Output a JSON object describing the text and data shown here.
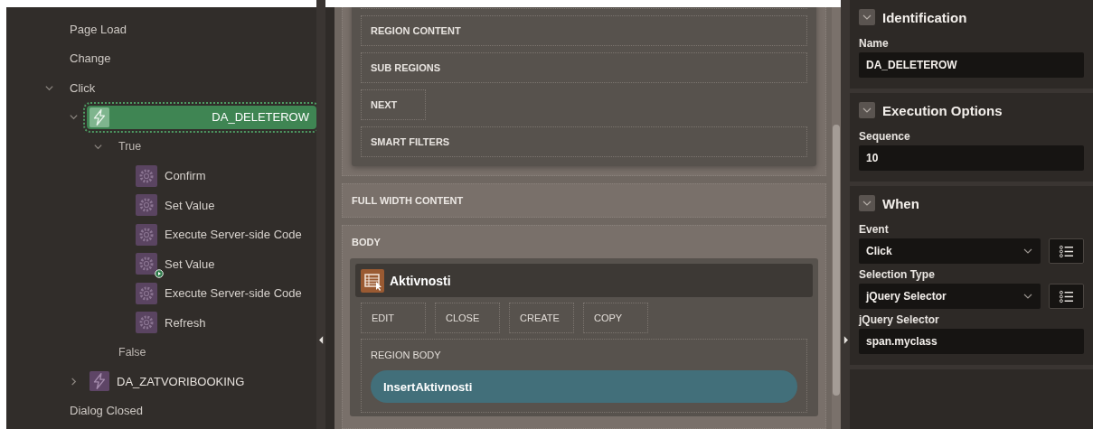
{
  "tree": [
    {
      "label": "Page Load",
      "kind": "event"
    },
    {
      "label": "Change",
      "kind": "event"
    },
    {
      "label": "Click",
      "kind": "event",
      "expanded": true,
      "children": [
        {
          "label": "DA_DELETEROW",
          "kind": "dynamic-action",
          "expanded": true,
          "selected": true,
          "children": [
            {
              "label": "True",
              "kind": "branch",
              "expanded": true,
              "children": [
                {
                  "label": "Confirm",
                  "kind": "action",
                  "marker": false
                },
                {
                  "label": "Set Value",
                  "kind": "action",
                  "marker": false
                },
                {
                  "label": "Execute Server-side Code",
                  "kind": "action",
                  "marker": false
                },
                {
                  "label": "Set Value",
                  "kind": "action",
                  "marker": true
                },
                {
                  "label": "Execute Server-side Code",
                  "kind": "action",
                  "marker": false
                },
                {
                  "label": "Refresh",
                  "kind": "action",
                  "marker": false
                }
              ]
            },
            {
              "label": "False",
              "kind": "branch"
            }
          ]
        },
        {
          "label": "DA_ZATVORIBOOKING",
          "kind": "dynamic-action",
          "expanded": false,
          "selected": false
        }
      ]
    },
    {
      "label": "Dialog Closed",
      "kind": "event"
    }
  ],
  "layout": {
    "top_slots": [
      {
        "label": "REGION CONTENT",
        "kind": "wide"
      },
      {
        "label": "SUB REGIONS",
        "kind": "wide"
      },
      {
        "label": "NEXT",
        "kind": "narrow"
      },
      {
        "label": "SMART FILTERS",
        "kind": "wide"
      }
    ],
    "full_width": "FULL WIDTH CONTENT",
    "body": {
      "label": "BODY",
      "region": {
        "title": "Aktivnosti",
        "buttons": [
          "EDIT",
          "CLOSE",
          "CREATE",
          "COPY"
        ],
        "region_body": {
          "label": "REGION BODY",
          "items": [
            "InsertAktivnosti"
          ]
        }
      }
    }
  },
  "properties": {
    "sections": [
      {
        "title": "Identification",
        "expanded": true,
        "fields": [
          {
            "label": "Name",
            "value": "DA_DELETEROW",
            "kind": "text"
          }
        ]
      },
      {
        "title": "Execution Options",
        "expanded": true,
        "fields": [
          {
            "label": "Sequence",
            "value": "10",
            "kind": "text"
          }
        ]
      },
      {
        "title": "When",
        "expanded": true,
        "fields": [
          {
            "label": "Event",
            "value": "Click",
            "kind": "select"
          },
          {
            "label": "Selection Type",
            "value": "jQuery Selector",
            "kind": "select"
          },
          {
            "label": "jQuery Selector",
            "value": "span.myclass",
            "kind": "text"
          }
        ]
      }
    ]
  }
}
